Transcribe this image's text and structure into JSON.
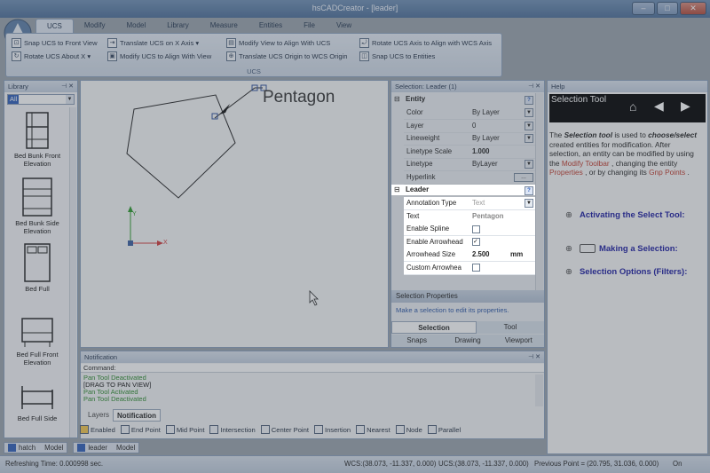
{
  "window": {
    "title": "hsCADCreator - [leader]",
    "minimize": "–",
    "maximize": "□",
    "close": "✕"
  },
  "ribbon": {
    "tabs": [
      "UCS",
      "Modify",
      "Model",
      "Library",
      "Measure",
      "Entities",
      "File",
      "View"
    ],
    "active_tab": "UCS",
    "group_label": "UCS",
    "buttons": {
      "snap_front": "Snap UCS to Front View",
      "rotate_about": "Rotate UCS About X ▾",
      "translate_x": "Translate UCS on X Axis ▾",
      "modify_align": "Modify UCS to Align With View",
      "modify_view": "Modify View to Align With UCS",
      "translate_origin": "Translate UCS Origin to WCS Origin",
      "rotate_axis": "Rotate UCS Axis to Align with WCS Axis",
      "snap_entities": "Snap UCS to Entities"
    }
  },
  "library": {
    "title": "Library",
    "filter": "All",
    "items": [
      "Bed Bunk Front Elevation",
      "Bed Bunk Side Elevation",
      "Bed Full",
      "Bed Full Front Elevation",
      "Bed Full Side"
    ]
  },
  "canvas": {
    "label": "Pentagon",
    "axis_x": "X",
    "axis_y": "Y"
  },
  "properties": {
    "title": "Selection: Leader (1)",
    "entity_section": "Entity",
    "entity_rows": [
      {
        "key": "Color",
        "value": "By Layer"
      },
      {
        "key": "Layer",
        "value": "0"
      },
      {
        "key": "Lineweight",
        "value": "By Layer"
      },
      {
        "key": "Linetype Scale",
        "value": "1.000"
      },
      {
        "key": "Linetype",
        "value": "ByLayer"
      },
      {
        "key": "Hyperlink",
        "value": ""
      }
    ],
    "leader_section": "Leader",
    "leader_rows": [
      {
        "key": "Annotation Type",
        "value": "Text"
      },
      {
        "key": "Text",
        "value": "Pentagon"
      },
      {
        "key": "Enable Spline",
        "value": ""
      },
      {
        "key": "Enable Arrowhead",
        "value": "✓"
      },
      {
        "key": "Arrowhead Size",
        "value": "2.500"
      },
      {
        "key": "Custom Arrowhea",
        "value": ""
      }
    ],
    "arrowhead_unit": "mm",
    "sel_props_title": "Selection Properties",
    "sel_props_hint": "Make a selection to edit its properties.",
    "bottom_tabs": [
      "Selection",
      "Tool"
    ],
    "bottom_tabs2": [
      "Snaps",
      "Drawing",
      "Viewport"
    ]
  },
  "help": {
    "title": "Help",
    "banner": "Selection Tool",
    "body_pre": "The ",
    "body_term": "Selection tool",
    "body_mid": " is used to ",
    "body_choose": "choose/select",
    "body_rest": " created entities for modification. After selection, an entity can be modified by using the ",
    "link_modify": "Modify Toolbar",
    "body_rest2": " , changing the entity ",
    "link_properties": "Properties",
    "body_rest3": " , or by changing its ",
    "link_gnp": "Gnp Points",
    "body_end": " .",
    "topics": [
      "Activating the Select Tool:",
      "Making a Selection:",
      "Selection Options (Filters):"
    ]
  },
  "notification": {
    "title": "Notification",
    "command_label": "Command:",
    "log": [
      {
        "text": "Pan Tool Deactivated",
        "color": "#2b8a2b"
      },
      {
        "text": "[DRAG TO PAN VIEW]",
        "color": "#111111"
      },
      {
        "text": "Pan Tool Activated",
        "color": "#2b8a2b"
      },
      {
        "text": "Pan Tool Deactivated",
        "color": "#2b8a2b"
      }
    ],
    "tabs": [
      "Layers",
      "Notification"
    ]
  },
  "snaps": [
    "Enabled",
    "End Point",
    "Mid Point",
    "Intersection",
    "Center Point",
    "Insertion",
    "Nearest",
    "Node",
    "Parallel"
  ],
  "doc_tabs": [
    {
      "name": "hatch",
      "view": "Model"
    },
    {
      "name": "leader",
      "view": "Model"
    }
  ],
  "status": {
    "refresh": "Refreshing Time: 0.000998 sec.",
    "wcs": "WCS:(38.073, -11.337, 0.000)",
    "ucs": "UCS:(38.073, -11.337, 0.000)",
    "previous": "Previous Point = (20.795, 31.036, 0.000)",
    "on": "On"
  },
  "colors": {
    "accent": "#4d6f99",
    "link": "#c0392b",
    "topic": "#1a1aa0"
  }
}
